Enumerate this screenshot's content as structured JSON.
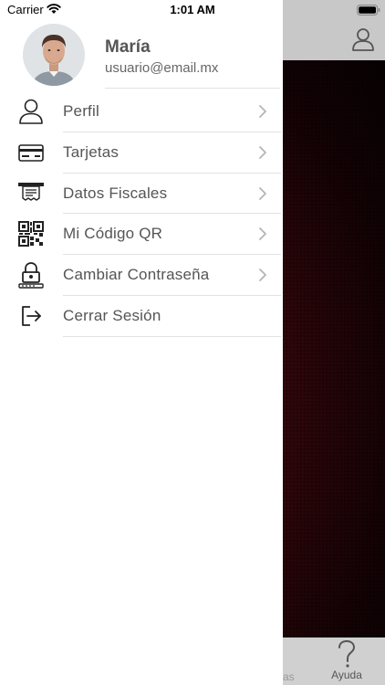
{
  "status_bar": {
    "carrier": "Carrier",
    "time": "1:01 AM"
  },
  "profile": {
    "name": "María",
    "email": "usuario@email.mx"
  },
  "menu": [
    {
      "label": "Perfil",
      "icon": "person-icon",
      "chevron": true
    },
    {
      "label": "Tarjetas",
      "icon": "credit-card-icon",
      "chevron": true
    },
    {
      "label": "Datos Fiscales",
      "icon": "receipt-icon",
      "chevron": true
    },
    {
      "label": "Mi Código QR",
      "icon": "qr-code-icon",
      "chevron": true
    },
    {
      "label": "Cambiar Contraseña",
      "icon": "lock-password-icon",
      "chevron": true
    },
    {
      "label": "Cerrar Sesión",
      "icon": "logout-icon",
      "chevron": false
    }
  ],
  "tabbar": {
    "partial_label": "as",
    "help_label": "Ayuda"
  },
  "colors": {
    "text": "#555555",
    "divider": "#e2e2e2",
    "background_accent": "#4a0a12"
  }
}
